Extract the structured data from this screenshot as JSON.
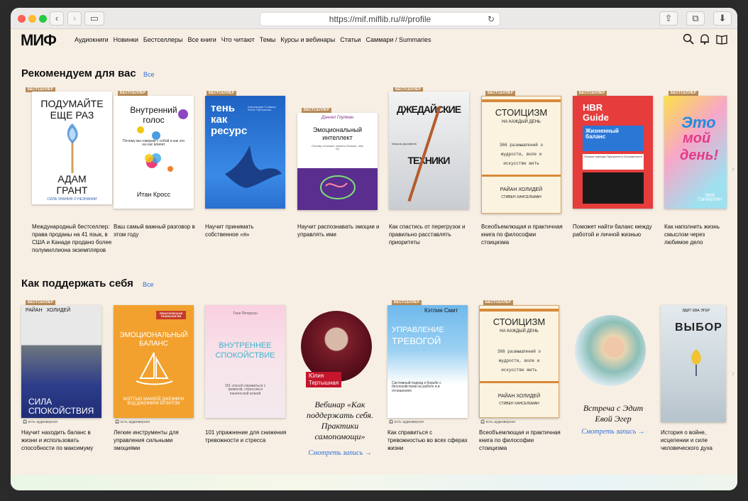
{
  "browser": {
    "url": "https://mif.miflib.ru/#/profile",
    "back_glyph": "‹",
    "forward_glyph": "›",
    "sidebar_glyph": "▭",
    "reload_glyph": "↻",
    "share_glyph": "⇪",
    "tabs_glyph": "⧉",
    "download_glyph": "⬇"
  },
  "site": {
    "logo": "МИФ",
    "nav": [
      "Аудиокниги",
      "Новинки",
      "Бестселлеры",
      "Все книги",
      "Что читают",
      "Темы",
      "Курсы и вебинары",
      "Статьи",
      "Саммари / Summaries"
    ]
  },
  "badge_text": "БЕСТСЕЛЛЕР",
  "audio_text": "есть аудиоверсия",
  "more_glyph": "›",
  "section1": {
    "title": "Рекомендуем для вас",
    "all": "Все",
    "books": [
      {
        "cover_lines": [
          "ПОДУМАЙТЕ",
          "ЕЩЕ РАЗ",
          "АДАМ",
          "ГРАНТ"
        ],
        "cover_extra": "СИЛА ЗНАНИЯ О НЕЗНАНИИ",
        "desc": "Международный бестселлер: права проданы на 41 язык, в США и Канаде продано более полумиллиона экземпляров"
      },
      {
        "cover_lines": [
          "Внутренний",
          "голос"
        ],
        "cover_extra": "Итан Кросс",
        "cover_sub": "Почему мы говорим с собой и как это на нас влияет",
        "desc": "Ваш самый важный разговор в этом году"
      },
      {
        "cover_lines": [
          "тень",
          "как",
          "ресурс"
        ],
        "cover_extra": "Александра Славина  Юлия Тертышная",
        "desc": "Научит принимать собственное «я»"
      },
      {
        "cover_lines": [
          "Эмоциональный",
          "интеллект"
        ],
        "cover_extra": "Дэниел Гоулман",
        "cover_sub": "Почему он может значить больше, чем IQ",
        "desc": "Научит распознавать эмоции и управлять ими"
      },
      {
        "cover_lines": [
          "ДЖЕДАЙСКИЕ",
          "ТЕХНИКИ"
        ],
        "cover_extra": "Максим Дорофеев",
        "desc": "Как спастись от перегрузок и правильно расставлять приоритеты"
      },
      {
        "cover_lines": [
          "СТОИЦИЗМ",
          "НА КАЖДЫЙ ДЕНЬ"
        ],
        "cover_extra": "РАЙАН ХОЛИДЕЙ",
        "cover_sub": "366 размышлений о мудрости, воле и искусстве жить",
        "cover_sub2": "СТИВЕН ХАНСЕЛЬМАН",
        "desc": "Всеобъемлющая и практичная книга по философии стоицизма"
      },
      {
        "cover_lines": [
          "HBR",
          "Guide"
        ],
        "cover_extra": "Жизненный баланс",
        "cover_sub": "Личные границы  Приоритеты  Осознанность",
        "desc": "Поможет найти баланс между работой и личной жизнью"
      },
      {
        "cover_lines": [
          "Это",
          "мой",
          "день!"
        ],
        "cover_extra": "ЭМИ ТЭНЖЕРИН",
        "desc": "Как наполнить жизнь смыслом через любимое дело"
      }
    ]
  },
  "section2": {
    "title": "Как поддержать себя",
    "all": "Все",
    "items": [
      {
        "cover_lines": [
          "СИЛА",
          "СПОКОЙСТВИЯ"
        ],
        "cover_extra": "РАЙАН   ХОЛИДЕЙ",
        "audio": true,
        "desc": "Научит находить баланс в жизни и использовать способности по максимуму"
      },
      {
        "cover_lines": [
          "ЭМОЦИОНАЛЬНЫЙ",
          "БАЛАНС"
        ],
        "cover_extra": "МЭТТЬЮ МАККЕЙ  ДЖЕФФРИ ВУД  ДЖЕФФРИ БРЭНТЛИ",
        "cover_sub": "ПРАКТИЧЕСКАЯ ПСИХОЛОГИЯ",
        "audio": true,
        "desc": "Легкие инструменты для управления сильными эмоциями"
      },
      {
        "cover_lines": [
          "ВНУТРЕННЕЕ",
          "СПОКОЙСТВИЕ"
        ],
        "cover_extra": "Таня Петерсон",
        "cover_sub": "101 способ справиться с тревогой, стрессом и панической атакой",
        "desc": "101 упражнение для снижения тревожности и стресса"
      },
      {
        "circle_name": [
          "Юлия",
          "Тертышная"
        ],
        "webinar": [
          "Вебинар «Как",
          "поддержать себя.",
          "Практики",
          "самопомощи»"
        ],
        "watch": "Смотреть запись →"
      },
      {
        "cover_lines": [
          "УПРАВЛЕНИЕ",
          "ТРЕВОГОЙ"
        ],
        "cover_extra": "Кэтлин Смит",
        "cover_sub": "Системный подход к борьбе с беспокойством на работе и в отношениях",
        "audio": true,
        "desc": "Как справиться с тревожностью во всех сферах жизни"
      },
      {
        "cover_lines": [
          "СТОИЦИЗМ",
          "НА КАЖДЫЙ ДЕНЬ"
        ],
        "cover_extra": "РАЙАН ХОЛИДЕЙ",
        "cover_sub": "366 размышлений о мудрости, воле и искусстве жить",
        "cover_sub2": "СТИВЕН ХАНСЕЛЬМАН",
        "audio": true,
        "desc": "Всеобъемлющая и практичная книга по философии стоицизма"
      },
      {
        "webinar": [
          "Встреча с Эдит",
          "Евой Эгер"
        ],
        "watch": "Смотреть запись →"
      },
      {
        "cover_lines": [
          "ВЫБОР"
        ],
        "cover_extra": "ЭДИТ ЕВА ЭГЕР",
        "desc": "История о войне, исцелении и силе человеческого духа"
      }
    ]
  }
}
